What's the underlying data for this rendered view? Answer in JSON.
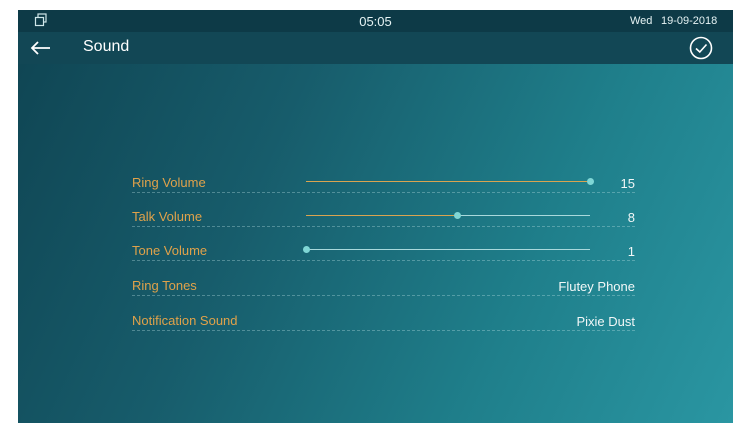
{
  "status_bar": {
    "time": "05:05",
    "day": "Wed",
    "date": "19-09-2018"
  },
  "header": {
    "title": "Sound"
  },
  "settings": [
    {
      "label": "Ring Volume",
      "value": "15",
      "slider": {
        "level": 15,
        "max": 15
      }
    },
    {
      "label": "Talk Volume",
      "value": "8",
      "slider": {
        "level": 8,
        "max": 15
      }
    },
    {
      "label": "Tone Volume",
      "value": "1",
      "slider": {
        "level": 0,
        "max": 15
      }
    },
    {
      "label": "Ring Tones",
      "value": "Flutey Phone"
    },
    {
      "label": "Notification Sound",
      "value": "Pixie Dust"
    }
  ],
  "colors": {
    "accent_label": "#e0a24a",
    "slider_thumb": "#7fd6d5",
    "background_start": "#0f4452",
    "background_end": "#2a96a2"
  }
}
